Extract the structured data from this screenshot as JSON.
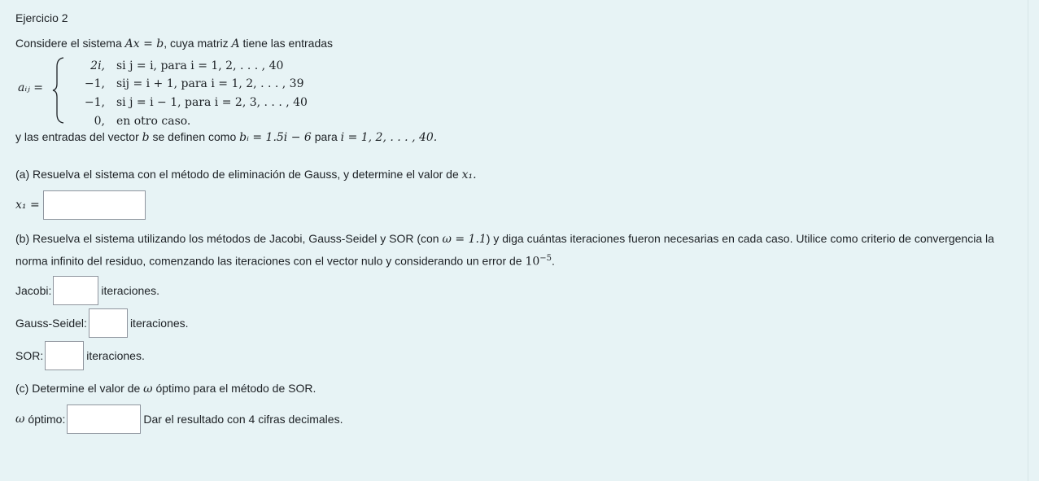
{
  "title": "Ejercicio 2",
  "intro": {
    "text1": "Considere el sistema",
    "eq": "Ax = b",
    "text2": ", cuya matriz",
    "A": "A",
    "text3": " tiene las entradas"
  },
  "definition": {
    "lhs": "aᵢⱼ =",
    "rows": [
      {
        "value": "2i,",
        "cond": "si j = i, para i = 1, 2, . . . , 40"
      },
      {
        "value": "−1,",
        "cond": "sij = i + 1, para i = 1, 2, . . . , 39"
      },
      {
        "value": "−1,",
        "cond": "si j = i − 1, para i = 2, 3, . . . , 40"
      },
      {
        "value": "0,",
        "cond": "en otro caso."
      }
    ]
  },
  "vector_def": {
    "text1": "y las entradas del vector",
    "b": "b",
    "text2": "se definen como",
    "bi": "bᵢ = 1.5i − 6",
    "text3": "para",
    "range": "i = 1, 2, . . . , 40."
  },
  "part_a": {
    "tag": "(a)",
    "text": "Resuelva el sistema con el método de eliminación de Gauss, y determine el valor de",
    "var": "x₁.",
    "input_label": "x₁ =",
    "input_value": ""
  },
  "part_b": {
    "tag": "(b)",
    "text1": "Resuelva el sistema utilizando los métodos de Jacobi, Gauss-Seidel y SOR (con",
    "omega": "ω = 1.1",
    "text2": ") y diga cuántas iteraciones fueron necesarias en cada caso. Utilice como criterio de convergencia la norma infinito del residuo, comenzando las iteraciones con el vector nulo y considerando un error de",
    "error_base": "10",
    "error_exp": "−5",
    "text3": ".",
    "methods": [
      {
        "label": "Jacobi:",
        "value": "",
        "suffix": "iteraciones."
      },
      {
        "label": "Gauss-Seidel:",
        "value": "",
        "suffix": "iteraciones."
      },
      {
        "label": "SOR:",
        "value": "",
        "suffix": "iteraciones."
      }
    ]
  },
  "part_c": {
    "tag": "(c)",
    "text1": "Determine el valor de",
    "omega": "ω",
    "text2": "óptimo para el método de SOR.",
    "input_label_omega": "ω",
    "input_label": "óptimo:",
    "input_value": "",
    "note": "Dar el resultado con 4 cifras decimales."
  }
}
